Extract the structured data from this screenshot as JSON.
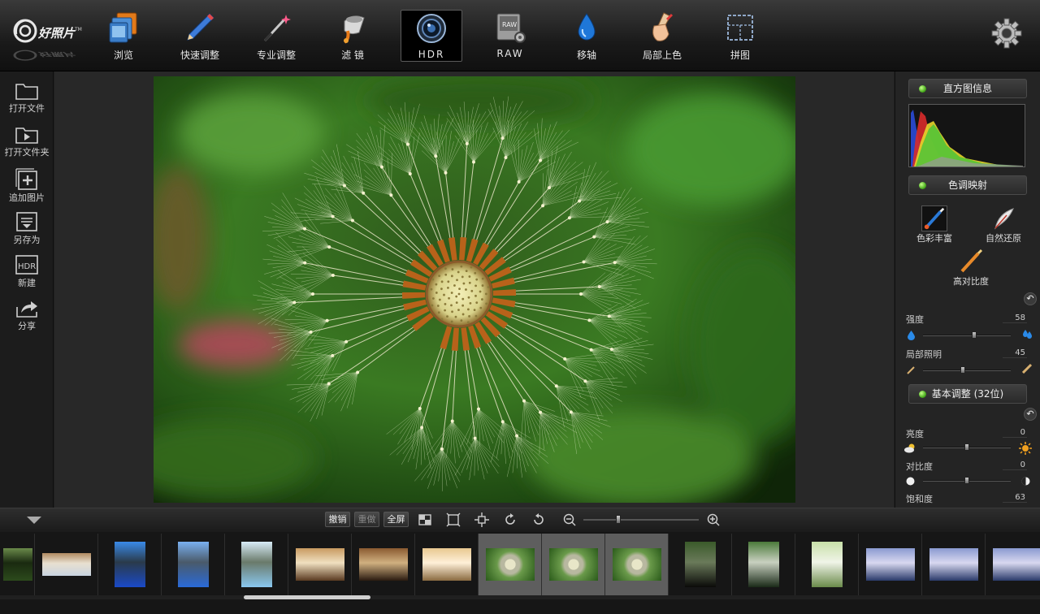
{
  "app": {
    "name": "好照片"
  },
  "toolbar": {
    "items": [
      {
        "label": "浏览",
        "icon": "browse-icon"
      },
      {
        "label": "快速调整",
        "icon": "pencil-icon"
      },
      {
        "label": "专业调整",
        "icon": "magic-wand-icon"
      },
      {
        "label": "滤 镜",
        "icon": "filter-icon"
      },
      {
        "label": "HDR",
        "icon": "hdr-lens-icon",
        "active": true
      },
      {
        "label": "RAW",
        "icon": "raw-icon"
      },
      {
        "label": "移轴",
        "icon": "water-drop-icon"
      },
      {
        "label": "局部上色",
        "icon": "brush-hand-icon"
      },
      {
        "label": "拼图",
        "icon": "collage-icon"
      }
    ],
    "settings_icon": "gear-icon"
  },
  "left_panel": {
    "items": [
      {
        "label": "打开文件",
        "icon": "folder-icon"
      },
      {
        "label": "打开文件夹",
        "icon": "folder-play-icon"
      },
      {
        "label": "追加图片",
        "icon": "add-image-icon"
      },
      {
        "label": "另存为",
        "icon": "save-as-icon"
      },
      {
        "label": "新建",
        "icon": "hdr-new-icon",
        "icon_text": "HDR"
      },
      {
        "label": "分享",
        "icon": "share-icon"
      }
    ]
  },
  "right_panel": {
    "histogram": {
      "title": "直方图信息"
    },
    "tone_mapping": {
      "title": "色调映射",
      "presets": [
        "色彩丰富",
        "自然还原",
        "高对比度"
      ],
      "undo_icon": "undo-icon",
      "sliders": [
        {
          "label": "强度",
          "value": 58,
          "min": 0,
          "max": 100
        },
        {
          "label": "局部照明",
          "value": 45,
          "min": 0,
          "max": 100
        }
      ]
    },
    "basic": {
      "title": "基本调整 (32位)",
      "undo_icon": "undo-icon",
      "sliders": [
        {
          "label": "亮度",
          "value": 0,
          "min": -100,
          "max": 100
        },
        {
          "label": "对比度",
          "value": 0,
          "min": -100,
          "max": 100
        },
        {
          "label": "饱和度",
          "value": 63
        }
      ]
    }
  },
  "bottom_bar": {
    "undo": "撤销",
    "redo": "重做",
    "fullscreen": "全屏",
    "zoom_level": 0.3
  },
  "filmstrip": {
    "thumbs": [
      {
        "kind": "forest"
      },
      {
        "kind": "building"
      },
      {
        "kind": "city-blue"
      },
      {
        "kind": "city-blue2"
      },
      {
        "kind": "city-light"
      },
      {
        "kind": "interior"
      },
      {
        "kind": "interior-dark"
      },
      {
        "kind": "interior-bright"
      },
      {
        "kind": "dandelion",
        "selected": true
      },
      {
        "kind": "dandelion",
        "selected": true
      },
      {
        "kind": "dandelion",
        "selected": true
      },
      {
        "kind": "waterfall-dark"
      },
      {
        "kind": "waterfall"
      },
      {
        "kind": "waterfall-bright"
      },
      {
        "kind": "lake"
      },
      {
        "kind": "lake"
      },
      {
        "kind": "lake"
      }
    ]
  }
}
